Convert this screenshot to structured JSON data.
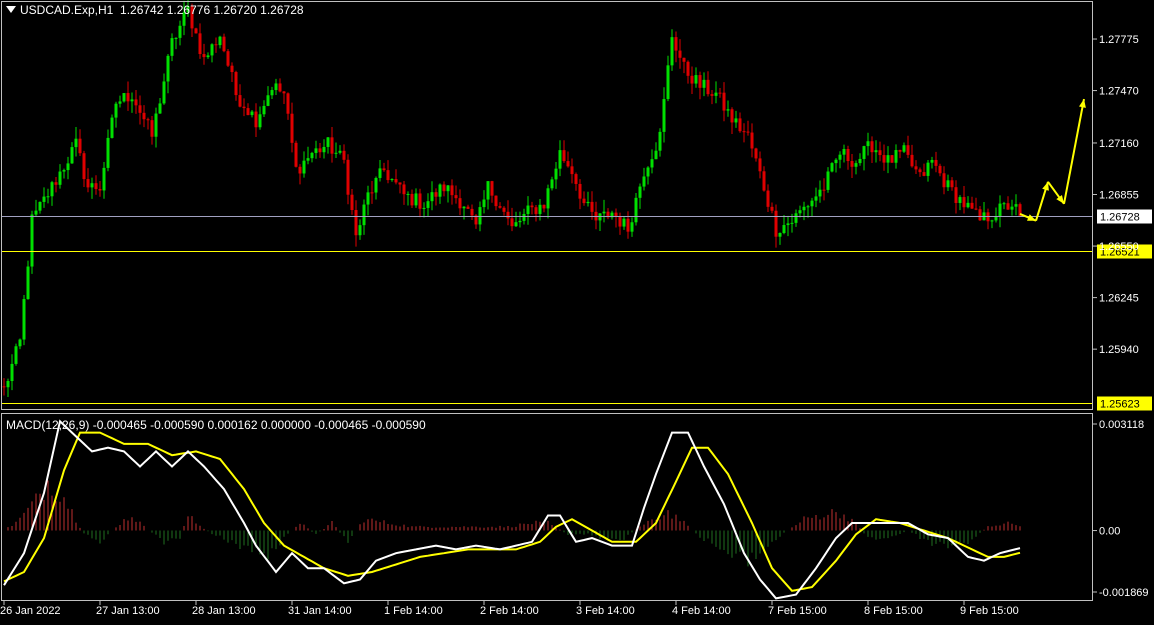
{
  "window": {
    "symbol": "USDCAD.Exp,H1",
    "ohlc": "1.26742 1.26776 1.26720 1.26728",
    "macd_label": "MACD(12,26,9) -0.000465 -0.000590 0.000162 0.000000 -0.000465 -0.000590"
  },
  "colors": {
    "background": "#000000",
    "bull_candle": "#00e000",
    "bear_candle": "#e00000",
    "support_line": "#ffff00",
    "bid_line": "#a0a0c0",
    "macd_main": "#ffffff",
    "macd_signal": "#ffff00",
    "hist_up": "#c03030",
    "hist_down": "#207020",
    "forecast_arrow": "#ffff00"
  },
  "chart_data": [
    {
      "type": "candlestick",
      "symbol": "USDCAD.Exp",
      "timeframe": "H1",
      "ylim": [
        1.2558,
        1.28
      ],
      "y_ticks": [
        "1.27775",
        "1.27470",
        "1.27160",
        "1.26855",
        "1.26550",
        "1.26245",
        "1.25940"
      ],
      "current_price": "1.26728",
      "levels": [
        {
          "label": "1.26521",
          "value": 1.26521
        },
        {
          "label": "1.25623",
          "value": 1.25623
        }
      ],
      "x_labels": [
        "26 Jan 2022",
        "27 Jan 13:00",
        "28 Jan 13:00",
        "31 Jan 14:00",
        "1 Feb 14:00",
        "2 Feb 14:00",
        "3 Feb 14:00",
        "4 Feb 14:00",
        "7 Feb 15:00",
        "8 Feb 15:00",
        "9 Feb 15:00"
      ],
      "x_label_bar_index": [
        0,
        24,
        48,
        72,
        96,
        120,
        144,
        168,
        192,
        216,
        240
      ],
      "close_anchors": [
        [
          0,
          1.257
        ],
        [
          4,
          1.2598
        ],
        [
          7,
          1.267
        ],
        [
          12,
          1.269
        ],
        [
          18,
          1.2715
        ],
        [
          21,
          1.269
        ],
        [
          24,
          1.269
        ],
        [
          28,
          1.274
        ],
        [
          32,
          1.2745
        ],
        [
          37,
          1.272
        ],
        [
          42,
          1.2775
        ],
        [
          46,
          1.2795
        ],
        [
          50,
          1.2765
        ],
        [
          54,
          1.278
        ],
        [
          58,
          1.2745
        ],
        [
          63,
          1.273
        ],
        [
          67,
          1.275
        ],
        [
          70,
          1.2745
        ],
        [
          73,
          1.27
        ],
        [
          77,
          1.271
        ],
        [
          81,
          1.2715
        ],
        [
          85,
          1.2705
        ],
        [
          88,
          1.266
        ],
        [
          91,
          1.2685
        ],
        [
          95,
          1.27
        ],
        [
          100,
          1.2685
        ],
        [
          105,
          1.268
        ],
        [
          110,
          1.269
        ],
        [
          115,
          1.268
        ],
        [
          118,
          1.2665
        ],
        [
          121,
          1.269
        ],
        [
          124,
          1.268
        ],
        [
          127,
          1.2665
        ],
        [
          131,
          1.2675
        ],
        [
          135,
          1.268
        ],
        [
          139,
          1.271
        ],
        [
          142,
          1.27
        ],
        [
          145,
          1.268
        ],
        [
          148,
          1.267
        ],
        [
          152,
          1.2675
        ],
        [
          156,
          1.2665
        ],
        [
          160,
          1.27
        ],
        [
          164,
          1.272
        ],
        [
          167,
          1.278
        ],
        [
          170,
          1.276
        ],
        [
          174,
          1.275
        ],
        [
          178,
          1.2745
        ],
        [
          182,
          1.273
        ],
        [
          186,
          1.272
        ],
        [
          190,
          1.269
        ],
        [
          193,
          1.2665
        ],
        [
          197,
          1.267
        ],
        [
          201,
          1.268
        ],
        [
          205,
          1.269
        ],
        [
          209,
          1.271
        ],
        [
          213,
          1.2705
        ],
        [
          217,
          1.2715
        ],
        [
          221,
          1.2705
        ],
        [
          225,
          1.271
        ],
        [
          229,
          1.2695
        ],
        [
          232,
          1.2705
        ],
        [
          236,
          1.269
        ],
        [
          240,
          1.268
        ],
        [
          244,
          1.267
        ],
        [
          248,
          1.2675
        ],
        [
          252,
          1.268
        ],
        [
          254,
          1.26728
        ]
      ],
      "forecast_path": [
        [
          254,
          1.2674
        ],
        [
          258,
          1.267
        ],
        [
          261,
          1.2693
        ],
        [
          265,
          1.268
        ],
        [
          270,
          1.2742
        ]
      ]
    },
    {
      "type": "macd",
      "params": [
        12,
        26,
        9
      ],
      "ylim": [
        -0.00187,
        0.00312
      ],
      "y_ticks": [
        "0.003118",
        "0.00",
        "-0.001869"
      ],
      "main_anchors": [
        [
          0,
          -0.00145
        ],
        [
          5,
          -0.0006
        ],
        [
          10,
          0.001
        ],
        [
          14,
          0.0029
        ],
        [
          17,
          0.0026
        ],
        [
          22,
          0.0021
        ],
        [
          26,
          0.0022
        ],
        [
          30,
          0.0021
        ],
        [
          34,
          0.0017
        ],
        [
          38,
          0.0021
        ],
        [
          42,
          0.0017
        ],
        [
          46,
          0.0021
        ],
        [
          50,
          0.0017
        ],
        [
          55,
          0.0011
        ],
        [
          60,
          0.0002
        ],
        [
          63,
          -0.0004
        ],
        [
          68,
          -0.0011
        ],
        [
          72,
          -0.0006
        ],
        [
          76,
          -0.001
        ],
        [
          80,
          -0.001
        ],
        [
          85,
          -0.0014
        ],
        [
          89,
          -0.0013
        ],
        [
          93,
          -0.0008
        ],
        [
          98,
          -0.0006
        ],
        [
          103,
          -0.0005
        ],
        [
          108,
          -0.0004
        ],
        [
          113,
          -0.0005
        ],
        [
          118,
          -0.0004
        ],
        [
          124,
          -0.0005
        ],
        [
          128,
          -0.0004
        ],
        [
          132,
          -0.0003
        ],
        [
          136,
          0.0004
        ],
        [
          139,
          0.0004
        ],
        [
          143,
          -0.0003
        ],
        [
          147,
          -0.0002
        ],
        [
          152,
          -0.0004
        ],
        [
          157,
          -0.0004
        ],
        [
          160,
          0.0006
        ],
        [
          163,
          0.0015
        ],
        [
          167,
          0.0026
        ],
        [
          171,
          0.0026
        ],
        [
          175,
          0.0017
        ],
        [
          180,
          0.0007
        ],
        [
          185,
          -0.0006
        ],
        [
          189,
          -0.0013
        ],
        [
          193,
          -0.0018
        ],
        [
          198,
          -0.0017
        ],
        [
          203,
          -0.001
        ],
        [
          208,
          -0.0002
        ],
        [
          212,
          0.0002
        ],
        [
          216,
          0.0002
        ],
        [
          220,
          0.0002
        ],
        [
          226,
          0.0002
        ],
        [
          231,
          -0.0001
        ],
        [
          236,
          -0.0002
        ],
        [
          241,
          -0.0007
        ],
        [
          245,
          -0.0008
        ],
        [
          249,
          -0.0006
        ],
        [
          254,
          -0.000465
        ]
      ],
      "signal_anchors": [
        [
          0,
          -0.00135
        ],
        [
          5,
          -0.0011
        ],
        [
          10,
          -0.0002
        ],
        [
          15,
          0.0016
        ],
        [
          19,
          0.0026
        ],
        [
          24,
          0.0026
        ],
        [
          30,
          0.0023
        ],
        [
          36,
          0.0023
        ],
        [
          42,
          0.002
        ],
        [
          48,
          0.0021
        ],
        [
          54,
          0.0019
        ],
        [
          60,
          0.0011
        ],
        [
          65,
          0.0002
        ],
        [
          70,
          -0.0004
        ],
        [
          75,
          -0.0007
        ],
        [
          80,
          -0.001
        ],
        [
          86,
          -0.0012
        ],
        [
          92,
          -0.0011
        ],
        [
          98,
          -0.0009
        ],
        [
          104,
          -0.0007
        ],
        [
          110,
          -0.0006
        ],
        [
          116,
          -0.0005
        ],
        [
          122,
          -0.0005
        ],
        [
          128,
          -0.0005
        ],
        [
          134,
          -0.0003
        ],
        [
          138,
          0.0001
        ],
        [
          142,
          0.0003
        ],
        [
          147,
          0.0
        ],
        [
          152,
          -0.0003
        ],
        [
          158,
          -0.0003
        ],
        [
          163,
          0.0002
        ],
        [
          168,
          0.0013
        ],
        [
          172,
          0.0022
        ],
        [
          176,
          0.0022
        ],
        [
          181,
          0.0015
        ],
        [
          187,
          0.0002
        ],
        [
          192,
          -0.001
        ],
        [
          197,
          -0.0016
        ],
        [
          202,
          -0.0015
        ],
        [
          208,
          -0.0008
        ],
        [
          213,
          -0.0001
        ],
        [
          218,
          0.0003
        ],
        [
          224,
          0.0002
        ],
        [
          230,
          0.0
        ],
        [
          236,
          -0.0002
        ],
        [
          242,
          -0.0005
        ],
        [
          246,
          -0.0007
        ],
        [
          250,
          -0.0007
        ],
        [
          254,
          -0.00059
        ]
      ],
      "histogram_anchors": [
        [
          0,
          0.0
        ],
        [
          4,
          0.0003
        ],
        [
          8,
          0.0008
        ],
        [
          11,
          0.0013
        ],
        [
          15,
          0.0009
        ],
        [
          20,
          -0.0001
        ],
        [
          24,
          -0.0003
        ],
        [
          29,
          0.0002
        ],
        [
          32,
          0.0004
        ],
        [
          36,
          0.0
        ],
        [
          40,
          -0.0003
        ],
        [
          44,
          -0.0002
        ],
        [
          46,
          0.0004
        ],
        [
          48,
          0.0002
        ],
        [
          52,
          -0.0001
        ],
        [
          57,
          -0.0003
        ],
        [
          62,
          -0.0005
        ],
        [
          66,
          -0.0007
        ],
        [
          70,
          -0.0002
        ],
        [
          74,
          0.0002
        ],
        [
          78,
          -0.0001
        ],
        [
          82,
          0.0002
        ],
        [
          86,
          -0.0003
        ],
        [
          90,
          0.0003
        ],
        [
          96,
          0.0002
        ],
        [
          102,
          0.0001
        ],
        [
          110,
          0.0001
        ],
        [
          118,
          0.0001
        ],
        [
          126,
          0.0001
        ],
        [
          132,
          0.0002
        ],
        [
          136,
          0.0002
        ],
        [
          141,
          -0.0001
        ],
        [
          146,
          -0.0001
        ],
        [
          150,
          -0.0002
        ],
        [
          155,
          -0.0002
        ],
        [
          159,
          0.0001
        ],
        [
          163,
          0.0003
        ],
        [
          166,
          0.0005
        ],
        [
          169,
          0.0003
        ],
        [
          173,
          -0.0001
        ],
        [
          178,
          -0.0004
        ],
        [
          183,
          -0.0008
        ],
        [
          188,
          -0.0007
        ],
        [
          192,
          -0.0003
        ],
        [
          196,
          0.0
        ],
        [
          200,
          0.0003
        ],
        [
          204,
          0.0004
        ],
        [
          208,
          0.0005
        ],
        [
          212,
          0.0003
        ],
        [
          216,
          -0.0002
        ],
        [
          221,
          -0.0002
        ],
        [
          226,
          0.0
        ],
        [
          231,
          -0.0003
        ],
        [
          236,
          -0.0004
        ],
        [
          241,
          -0.0003
        ],
        [
          246,
          0.0001
        ],
        [
          250,
          0.0002
        ],
        [
          254,
          0.000162
        ]
      ]
    }
  ]
}
